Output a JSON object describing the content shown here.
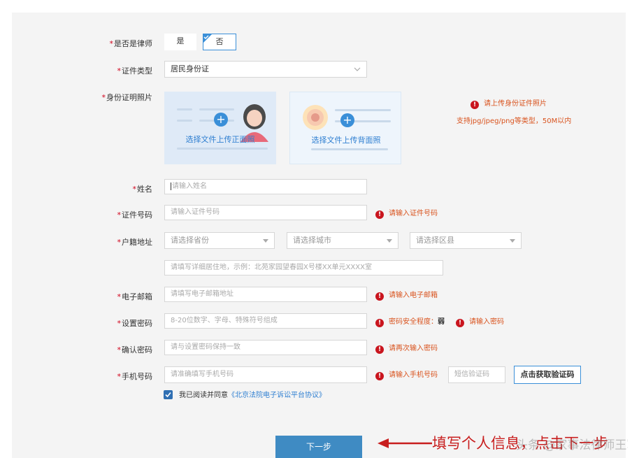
{
  "required_mark": "*",
  "labels": {
    "is_lawyer": "是否是律师",
    "id_type": "证件类型",
    "id_photo": "身份证明照片",
    "name": "姓名",
    "id_number": "证件号码",
    "address": "户籍地址",
    "email": "电子邮箱",
    "password": "设置密码",
    "confirm_password": "确认密码",
    "phone": "手机号码"
  },
  "lawyer_toggle": {
    "yes": "是",
    "no": "否",
    "selected": "否"
  },
  "id_type_select": {
    "value": "居民身份证"
  },
  "upload": {
    "front_label": "选择文件上传正面照",
    "back_label": "选择文件上传背面照",
    "error": "请上传身份证件照片",
    "hint": "支持jpg/jpeg/png等类型，50M以内"
  },
  "placeholders": {
    "name": "请输入姓名",
    "id_number": "请输入证件号码",
    "province": "请选择省份",
    "city": "请选择城市",
    "district": "请选择区县",
    "address_detail": "请填写详细居住地，示例：北苑家园望春园X号楼XX单元XXXX室",
    "email": "请填写电子邮箱地址",
    "password": "8-20位数字、字母、特殊符号组成",
    "confirm_password": "请与设置密码保持一致",
    "phone": "请准确填写手机号码",
    "sms_code": "短信验证码"
  },
  "errors": {
    "id_number": "请输入证件号码",
    "email": "请输入电子邮箱",
    "password_strength_label": "密码安全程度：",
    "password_strength_value": "弱",
    "password": "请输入密码",
    "confirm_password": "请再次输入密码",
    "phone": "请输入手机号码"
  },
  "sms_button": "点击获取验证码",
  "agreement": {
    "checked": true,
    "text": "我已阅读并同意",
    "link": "《北京法院电子诉讼平台协议》"
  },
  "next_button": "下一步",
  "annotation": "填写个人信息，点击下一步",
  "watermark": "头条 @家事法律师王军律师说法网事",
  "colors": {
    "primary": "#3a8fd8",
    "next_button": "#3f8bc3",
    "error": "#d9531e",
    "error_icon": "#c9151e",
    "annotation": "#c81e1e"
  },
  "icons": [
    "error-icon",
    "plus-icon",
    "chevron-down-icon",
    "checkmark-icon",
    "arrow-left-icon"
  ]
}
